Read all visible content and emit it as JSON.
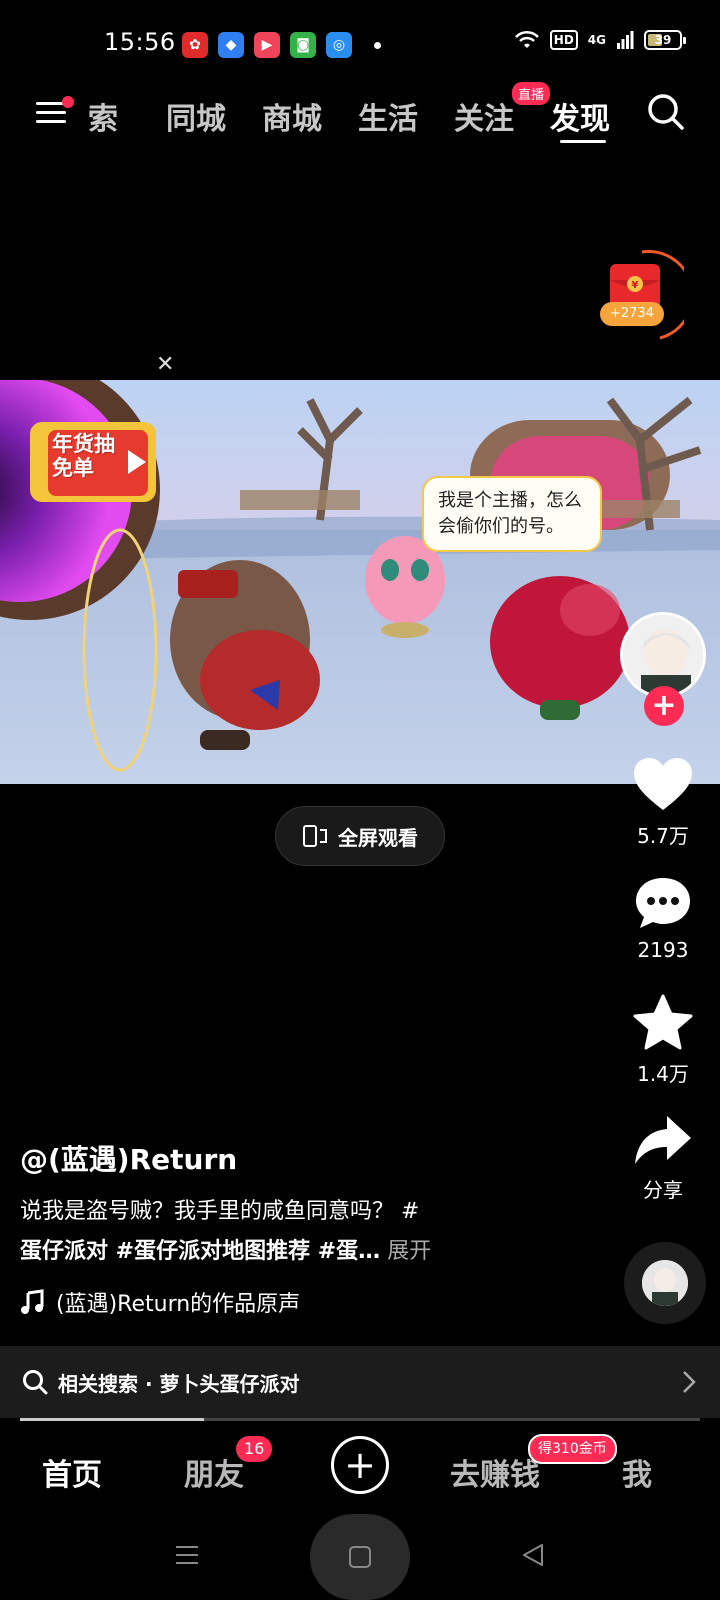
{
  "status_bar": {
    "time": "15:56",
    "hd": "HD",
    "network": "4G",
    "battery": "39"
  },
  "top_nav": {
    "tabs": [
      "索",
      "同城",
      "商城",
      "生活",
      "关注",
      "发现"
    ],
    "active_tab": "发现",
    "live_badge": "直播"
  },
  "red_packet": {
    "coins": "+2734"
  },
  "video": {
    "speech_bubble": "我是个主播，怎么会偷你们的号。",
    "promo": "年货抽免单"
  },
  "fullscreen": {
    "label": "全屏观看"
  },
  "rail": {
    "likes": "5.7万",
    "comments": "2193",
    "favorites": "1.4万",
    "share": "分享"
  },
  "caption": {
    "author": "@(蓝遇)Return",
    "text": "说我是盗号贼？我手里的咸鱼同意吗？ #",
    "tags": "蛋仔派对 #蛋仔派对地图推荐 #蛋…",
    "more": "展开",
    "music": "(蓝遇)Return的作品原声"
  },
  "related_search": {
    "label": "相关搜索 · 萝卜头蛋仔派对"
  },
  "playback": {
    "progress": 0.27
  },
  "bottom_nav": {
    "home": "首页",
    "friends": "朋友",
    "friends_badge": "16",
    "earn": "去赚钱",
    "earn_badge": "得310金币",
    "me": "我"
  },
  "colors": {
    "accent": "#fe2c55",
    "background": "#000000"
  }
}
